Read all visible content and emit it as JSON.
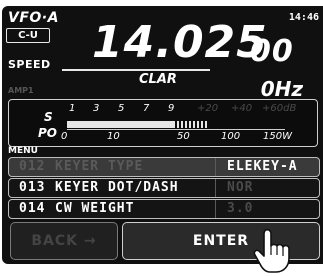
{
  "header": {
    "vfo_label": "VFO·A",
    "mode": "C-U",
    "clock": "14:46",
    "speed_label": "SPEED"
  },
  "frequency": {
    "main": "14.025",
    "sub": "00"
  },
  "clar": {
    "label": "CLAR",
    "value": "0Hz"
  },
  "amp_label": "AMP1",
  "meter": {
    "s_label": "S",
    "po_label": "PO",
    "s_scale": [
      "1",
      "3",
      "5",
      "7",
      "9",
      "+20",
      "+40",
      "+60dB"
    ],
    "po_scale": [
      "0",
      "10",
      "50",
      "100",
      "150W"
    ]
  },
  "menu": {
    "label": "MENU",
    "items": [
      {
        "number": "012",
        "name": "KEYER TYPE",
        "value": "ELEKEY-A",
        "selected": true
      },
      {
        "number": "013",
        "name": "KEYER DOT/DASH",
        "value": "NOR",
        "selected": false
      },
      {
        "number": "014",
        "name": "CW WEIGHT",
        "value": "3.0",
        "selected": false
      }
    ]
  },
  "buttons": {
    "back": "BACK",
    "enter": "ENTER"
  }
}
